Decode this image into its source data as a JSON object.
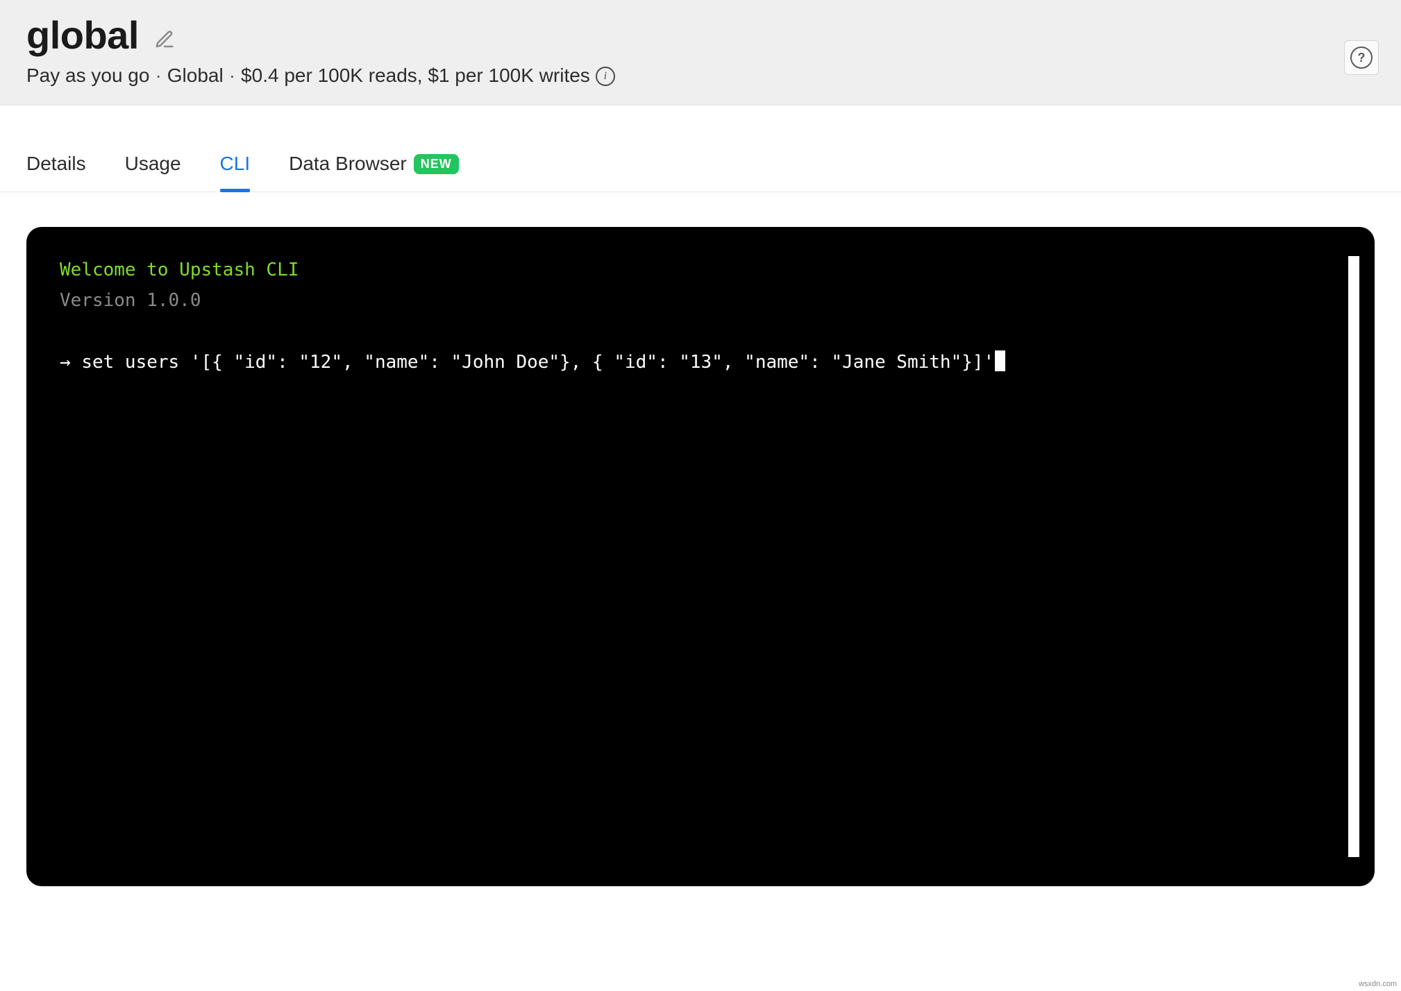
{
  "header": {
    "title": "global",
    "subtitle_parts": {
      "plan": "Pay as you go",
      "region": "Global",
      "pricing": "$0.4 per 100K reads, $1 per 100K writes"
    }
  },
  "tabs": {
    "details": "Details",
    "usage": "Usage",
    "cli": "CLI",
    "data_browser": "Data Browser",
    "badge_new": "NEW",
    "active": "cli"
  },
  "terminal": {
    "welcome": "Welcome to Upstash CLI",
    "version": "Version 1.0.0",
    "prompt_arrow": "→ ",
    "command": "set users '[{ \"id\": \"12\", \"name\": \"John Doe\"}, { \"id\": \"13\", \"name\": \"Jane Smith\"}]'"
  },
  "footer": {
    "source": "wsxdn.com"
  }
}
